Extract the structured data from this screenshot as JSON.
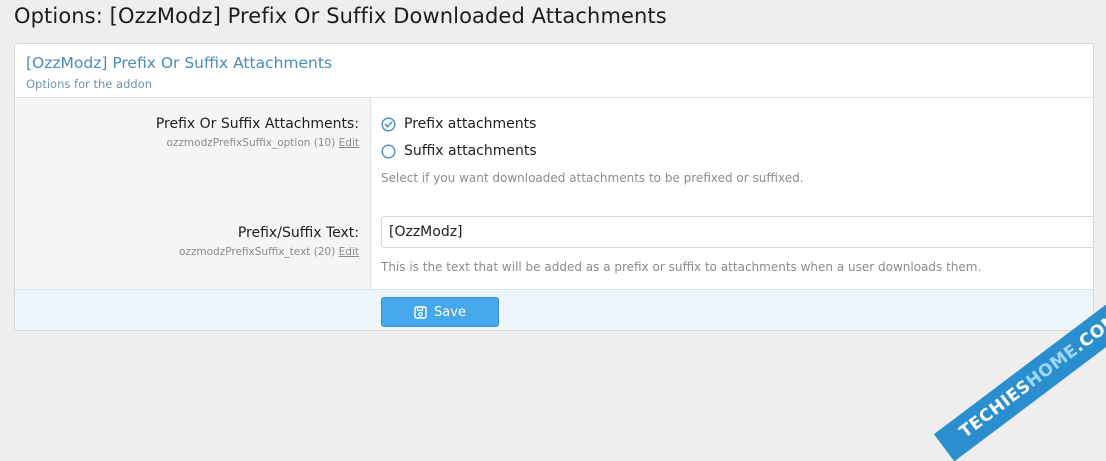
{
  "page": {
    "title": "Options: [OzzModz] Prefix Or Suffix Downloaded Attachments"
  },
  "block": {
    "title": "[OzzModz] Prefix Or Suffix Attachments",
    "description": "Options for the addon"
  },
  "option1": {
    "label": "Prefix Or Suffix Attachments:",
    "hint": "ozzmodzPrefixSuffix_option (10)",
    "edit_label": "Edit",
    "choices": [
      {
        "label": "Prefix attachments",
        "checked": true
      },
      {
        "label": "Suffix attachments",
        "checked": false
      }
    ],
    "explain": "Select if you want downloaded attachments to be prefixed or suffixed."
  },
  "option2": {
    "label": "Prefix/Suffix Text:",
    "hint": "ozzmodzPrefixSuffix_text (20)",
    "edit_label": "Edit",
    "value": "[OzzModz]",
    "explain": "This is the text that will be added as a prefix or suffix to attachments when a user downloads them."
  },
  "footer": {
    "save_label": "Save",
    "save_icon": "save-icon"
  },
  "watermark": {
    "part1": "TECHIES",
    "part2": "HOME",
    "part3": ".COM"
  },
  "colors": {
    "accent": "#47a7eb",
    "link_title": "#4a8bbd",
    "footer_bg": "#edf4fa"
  }
}
